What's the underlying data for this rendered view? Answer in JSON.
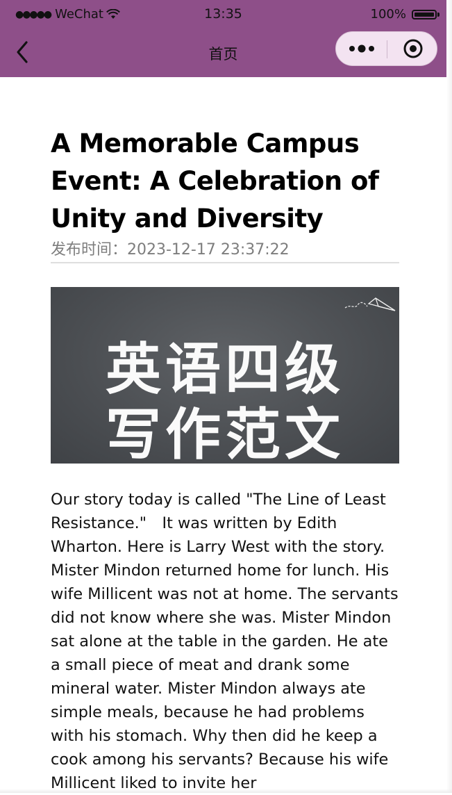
{
  "status_bar": {
    "carrier": "WeChat",
    "time": "13:35",
    "battery": "100%"
  },
  "navbar": {
    "title": "首页"
  },
  "article": {
    "title": "A Memorable Campus Event: A Celebration of Unity and Diversity",
    "publish_time": "发布时间：2023-12-17 23:37:22",
    "cover": {
      "line1": "英语四级",
      "line2": "写作范文"
    },
    "body": "Our story today is called \"The Line of Least Resistance.\"　It was written by Edith Wharton. Here is Larry West with the story. Mister Mindon returned home for lunch. His wife Millicent was not at home. The servants did not know where she was. Mister Mindon sat alone at the table in the garden. He ate a small piece of meat and drank some mineral water. Mister Mindon always ate simple meals, because he had problems with his stomach. Why then did he keep a cook among his servants? Because his wife Millicent liked to invite her"
  },
  "colors": {
    "nav_background": "#8e4f89",
    "capsule_background": "#f3e3f1",
    "meta_text": "#7d7d7d"
  },
  "icons": [
    "wifi-icon",
    "battery-icon",
    "back-arrow-icon",
    "more-dots-icon",
    "close-target-icon",
    "paper-plane-icon"
  ]
}
